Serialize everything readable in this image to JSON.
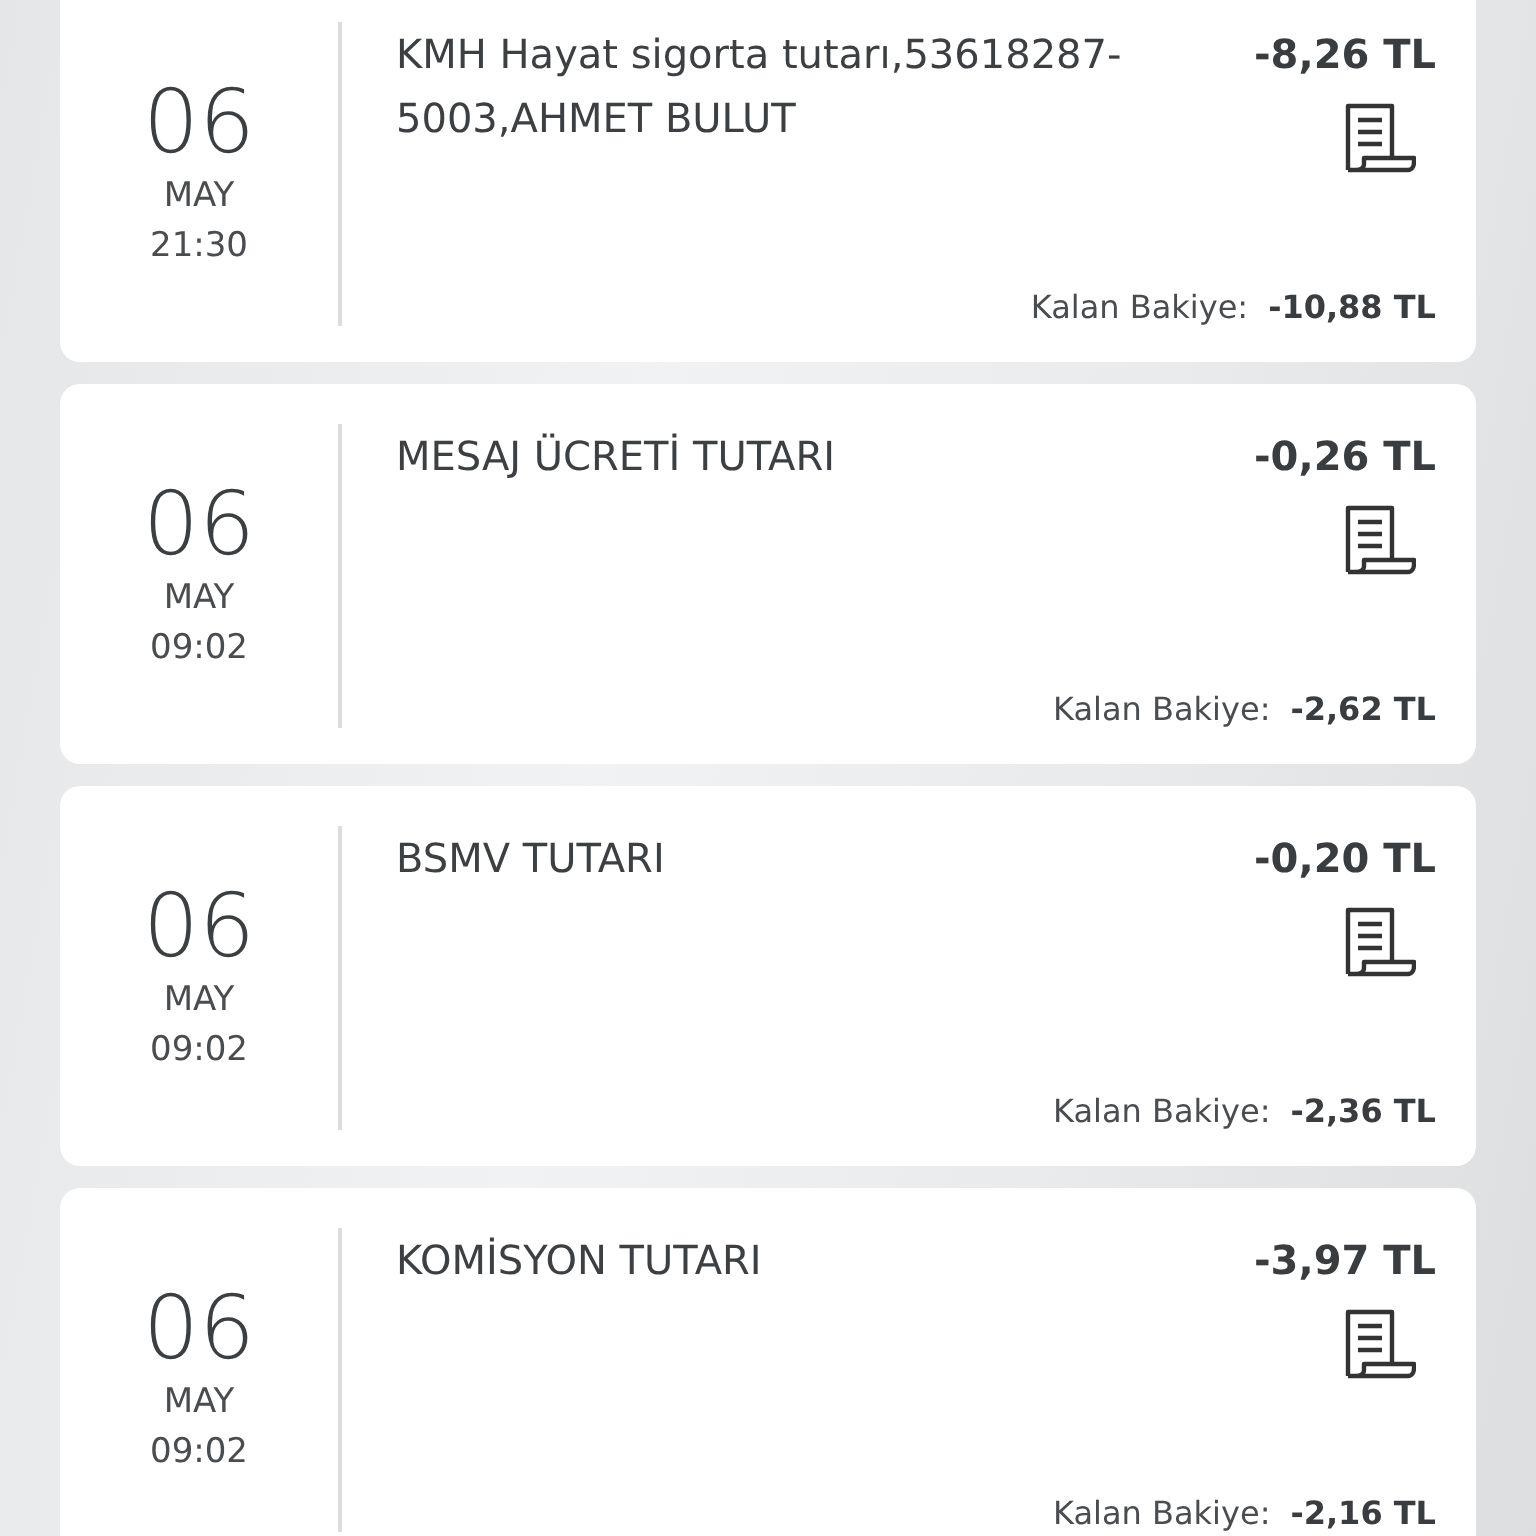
{
  "transactions": [
    {
      "day": "06",
      "month": "MAY",
      "time": "21:30",
      "description": "KMH Hayat sigorta tutarı,53618287-5003,AHMET BULUT",
      "amount": "-8,26 TL",
      "balance_label": "Kalan Bakiye:",
      "balance": "-10,88 TL"
    },
    {
      "day": "06",
      "month": "MAY",
      "time": "09:02",
      "description": "MESAJ ÜCRETİ TUTARI",
      "amount": "-0,26 TL",
      "balance_label": "Kalan Bakiye:",
      "balance": "-2,62 TL"
    },
    {
      "day": "06",
      "month": "MAY",
      "time": "09:02",
      "description": "BSMV TUTARI",
      "amount": "-0,20 TL",
      "balance_label": "Kalan Bakiye:",
      "balance": "-2,36 TL"
    },
    {
      "day": "06",
      "month": "MAY",
      "time": "09:02",
      "description": "KOMİSYON TUTARI",
      "amount": "-3,97 TL",
      "balance_label": "Kalan Bakiye:",
      "balance": "-2,16 TL"
    }
  ]
}
